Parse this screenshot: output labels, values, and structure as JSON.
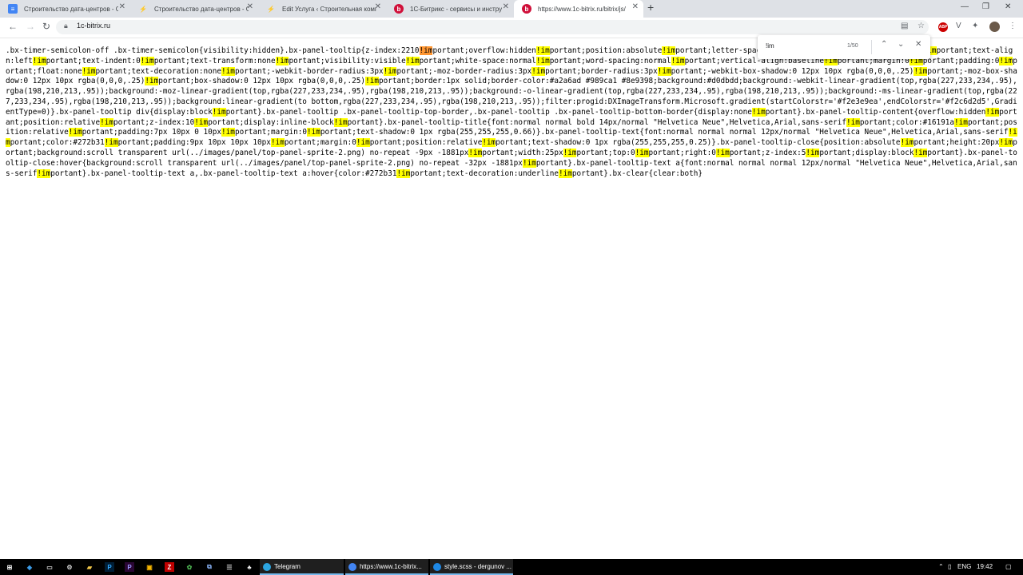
{
  "browser": {
    "tabs": [
      {
        "label": "Строительство дата-центров - G",
        "icon": "docs-icon",
        "active": false
      },
      {
        "label": "Строительство дата-центров - G",
        "icon": "bitrix-yellow-icon",
        "active": false
      },
      {
        "label": "Edit Услуга ‹ Строительная комп",
        "icon": "edit-icon",
        "active": false
      },
      {
        "label": "1С-Битрикс - сервисы и инстру",
        "icon": "bitrix-red-icon",
        "active": false
      },
      {
        "label": "https://www.1c-bitrix.ru/bitrix/js/",
        "icon": "bitrix-red-icon",
        "active": true
      }
    ],
    "new_tab": "+",
    "url": "1c-bitrix.ru",
    "abp_label": "ABP"
  },
  "find": {
    "query": "!im",
    "count": "1/50"
  },
  "page": {
    "code": ".bx-timer-semicolon-off .bx-timer-semicolon{visibility:hidden}.bx-panel-tooltip{z-index:2210!important;overflow:hidden!important;position:absolute!important;letter-spacing:normal!important;list-style:none!important;text-align:left!important;text-indent:0!important;text-transform:none!important;visibility:visible!important;white-space:normal!important;word-spacing:normal!important;vertical-align:baseline!important;margin:0!important;padding:0!important;float:none!important;text-decoration:none!important;-webkit-border-radius:3px!important;-moz-border-radius:3px!important;border-radius:3px!important;-webkit-box-shadow:0 12px 10px rgba(0,0,0,.25)!important;-moz-box-shadow:0 12px 10px rgba(0,0,0,.25)!important;box-shadow:0 12px 10px rgba(0,0,0,.25)!important;border:1px solid;border-color:#a2a6ad #989ca1 #8e9398;background:#d0dbdd;background:-webkit-linear-gradient(top,rgba(227,233,234,.95),rgba(198,210,213,.95));background:-moz-linear-gradient(top,rgba(227,233,234,.95),rgba(198,210,213,.95));background:-o-linear-gradient(top,rgba(227,233,234,.95),rgba(198,210,213,.95));background:-ms-linear-gradient(top,rgba(227,233,234,.95),rgba(198,210,213,.95));background:linear-gradient(to bottom,rgba(227,233,234,.95),rgba(198,210,213,.95));filter:progid:DXImageTransform.Microsoft.gradient(startColorstr='#f2e3e9ea',endColorstr='#f2c6d2d5',GradientType=0)}.bx-panel-tooltip div{display:block!important}.bx-panel-tooltip .bx-panel-tooltip-top-border,.bx-panel-tooltip .bx-panel-tooltip-bottom-border{display:none!important}.bx-panel-tooltip-content{overflow:hidden!important;position:relative!important;z-index:10!important;display:inline-block!important}.bx-panel-tooltip-title{font:normal normal bold 14px/normal \"Helvetica Neue\",Helvetica,Arial,sans-serif!important;color:#16191a!important;position:relative!important;padding:7px 10px 0 10px!important;margin:0!important;text-shadow:0 1px rgba(255,255,255,0.66)}.bx-panel-tooltip-text{font:normal normal normal 12px/normal \"Helvetica Neue\",Helvetica,Arial,sans-serif!important;color:#272b31!important;padding:9px 10px 10px 10px!important;margin:0!important;position:relative!important;text-shadow:0 1px rgba(255,255,255,0.25)}.bx-panel-tooltip-close{position:absolute!important;height:20px!important;background:scroll transparent url(../images/panel/top-panel-sprite-2.png) no-repeat -9px -1881px!important;width:25px!important;top:0!important;right:0!important;z-index:5!important;display:block!important}.bx-panel-tooltip-close:hover{background:scroll transparent url(../images/panel/top-panel-sprite-2.png) no-repeat -32px -1881px!important}.bx-panel-tooltip-text a{font:normal normal normal 12px/normal \"Helvetica Neue\",Helvetica,Arial,sans-serif!important}.bx-panel-tooltip-text a,.bx-panel-tooltip-text a:hover{color:#272b31!important;text-decoration:underline!important}.bx-clear{clear:both}"
  },
  "taskbar": {
    "apps": [
      {
        "label": "Telegram",
        "icon": "telegram-icon",
        "color": "#2ca5e0"
      },
      {
        "label": "https://www.1c-bitrix...",
        "icon": "chrome-icon",
        "color": "#4285f4"
      },
      {
        "label": "style.scss - dergunov ...",
        "icon": "vscode-icon",
        "color": "#1e88e5"
      }
    ],
    "lang": "ENG",
    "time": "19:42"
  },
  "colors": {
    "highlight": "#ffff00",
    "current_highlight": "#ff9632",
    "tabstrip": "#dee1e6"
  }
}
